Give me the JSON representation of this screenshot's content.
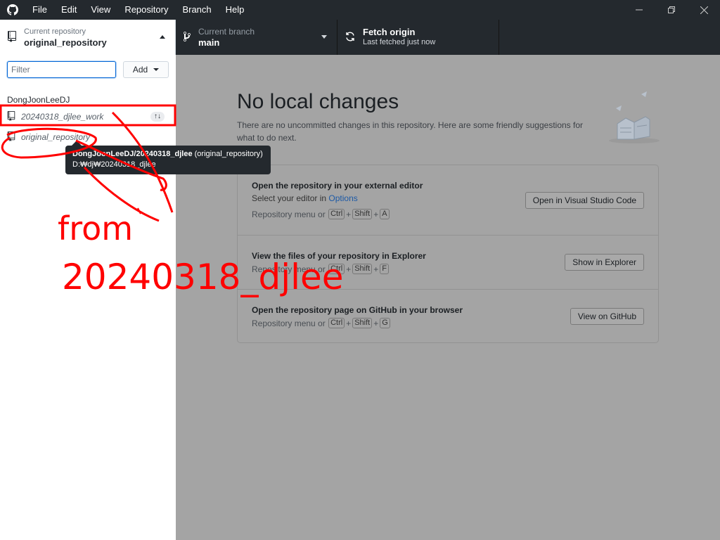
{
  "titlebar": {
    "menu": [
      "File",
      "Edit",
      "View",
      "Repository",
      "Branch",
      "Help"
    ]
  },
  "toolbar": {
    "repo": {
      "description": "Current repository",
      "title": "original_repository"
    },
    "branch": {
      "description": "Current branch",
      "title": "main"
    },
    "fetch": {
      "title": "Fetch origin",
      "description": "Last fetched just now"
    }
  },
  "sidebar": {
    "filter_placeholder": "Filter",
    "add_label": "Add",
    "group_header": "DongJoonLeeDJ",
    "repos": [
      {
        "name": "20240318_djlee_work",
        "sync": "↑↓"
      },
      {
        "name": "original_repository"
      }
    ]
  },
  "tooltip": {
    "title": "DongJoonLeeDJ/20240318_djlee",
    "suffix": " (original_repository)",
    "path": "D:₩dj₩20240318_djlee"
  },
  "main": {
    "heading": "No local changes",
    "subtext": "There are no uncommitted changes in this repository. Here are some friendly suggestions for what to do next.",
    "cards": [
      {
        "title": "Open the repository in your external editor",
        "line_prefix": "Select your editor in ",
        "line_link": "Options",
        "shortcut_prefix": "Repository menu or",
        "keys": [
          "Ctrl",
          "Shift",
          "A"
        ],
        "button": "Open in Visual Studio Code"
      },
      {
        "title": "View the files of your repository in Explorer",
        "shortcut_prefix": "Repository menu or",
        "keys": [
          "Ctrl",
          "Shift",
          "F"
        ],
        "button": "Show in Explorer"
      },
      {
        "title": "Open the repository page on GitHub in your browser",
        "shortcut_prefix": "Repository menu or",
        "keys": [
          "Ctrl",
          "Shift",
          "G"
        ],
        "button": "View on GitHub"
      }
    ]
  },
  "annotation": {
    "line1": "from",
    "line2": "20240318_djlee",
    "color": "#ff0000"
  }
}
